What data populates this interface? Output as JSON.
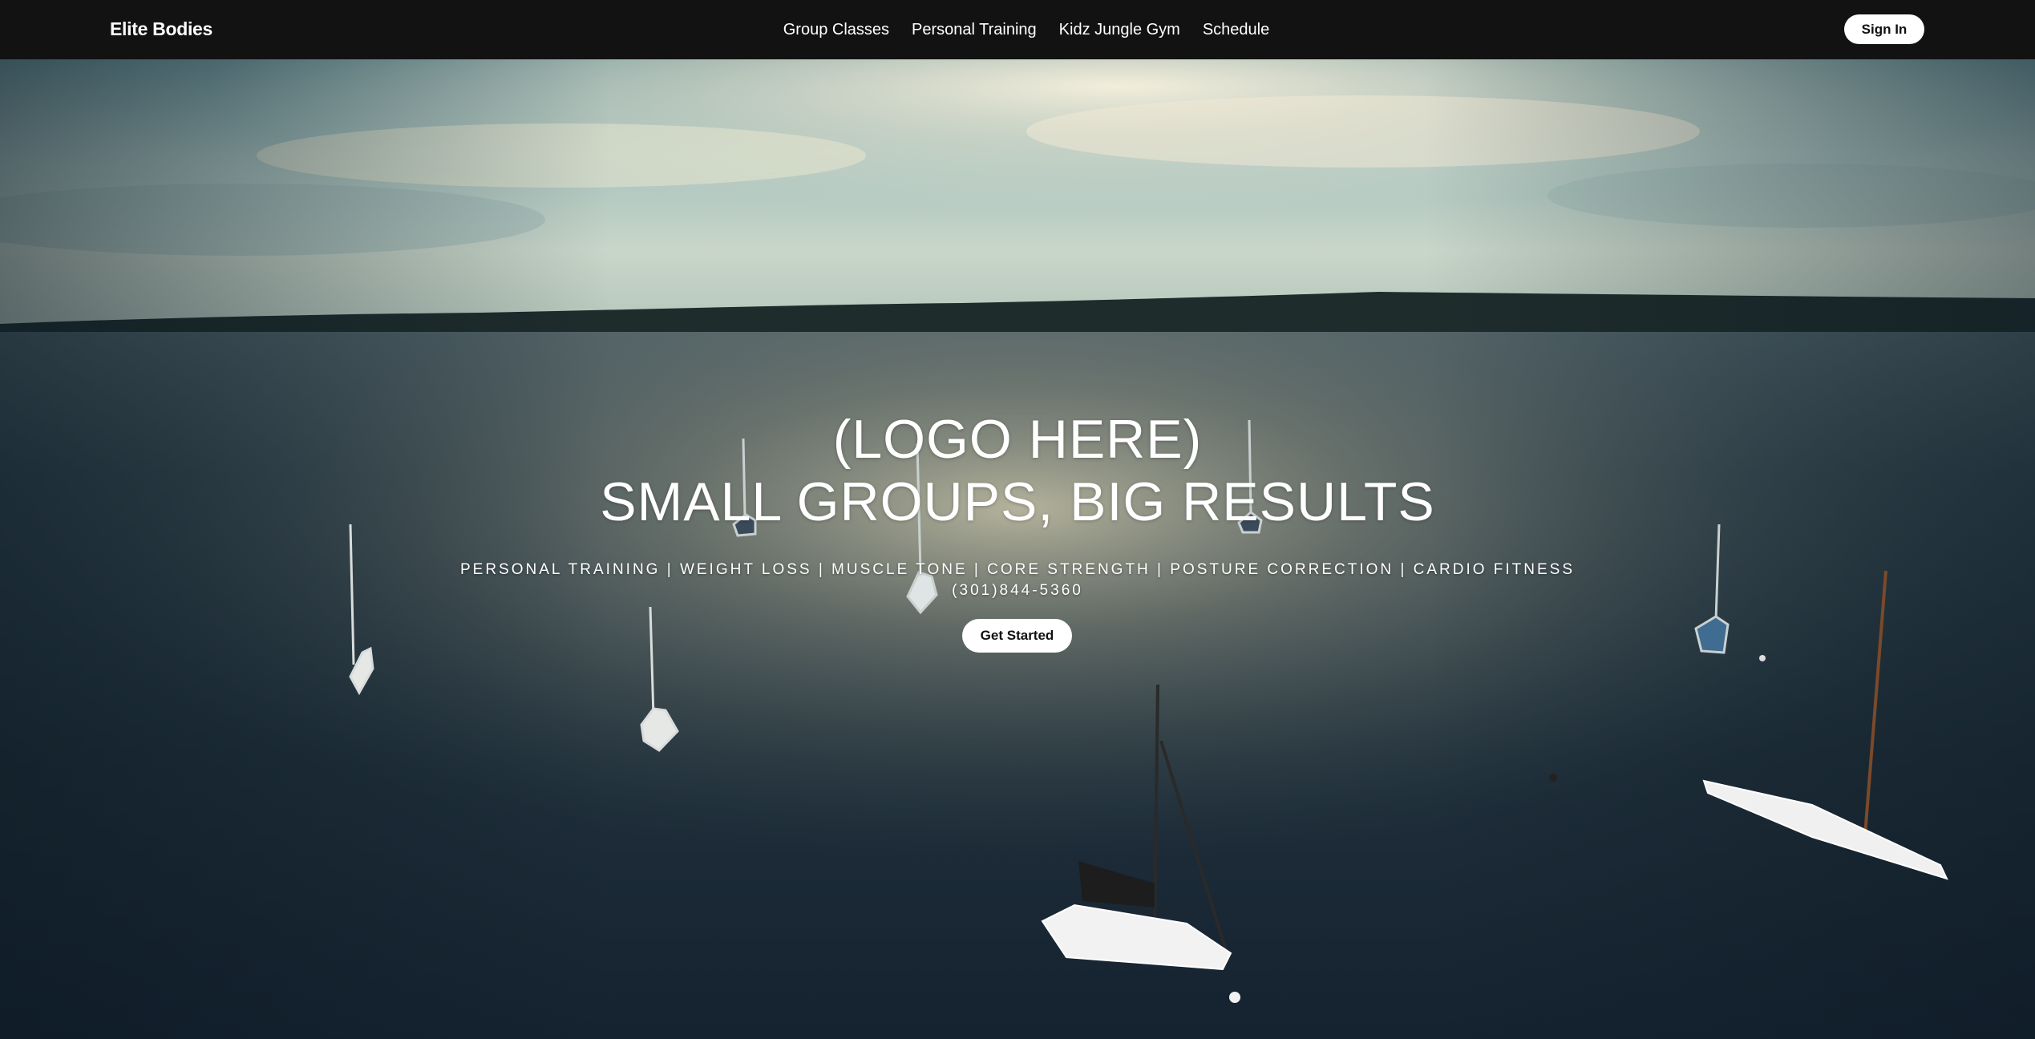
{
  "navbar": {
    "brand": "Elite Bodies",
    "links": [
      "Group Classes",
      "Personal Training",
      "Kidz Jungle Gym",
      "Schedule"
    ],
    "signin_label": "Sign In"
  },
  "hero": {
    "logo_placeholder": "(LOGO HERE)",
    "headline": "SMALL GROUPS, BIG RESULTS",
    "services": "PERSONAL TRAINING | WEIGHT LOSS | MUSCLE TONE | CORE STRENGTH | POSTURE CORRECTION | CARDIO FITNESS",
    "phone": "(301)844-5360",
    "cta_label": "Get Started"
  },
  "colors": {
    "navbar_bg": "#121212",
    "button_bg": "#ffffff",
    "button_text": "#111111",
    "hero_text": "#ffffff"
  }
}
